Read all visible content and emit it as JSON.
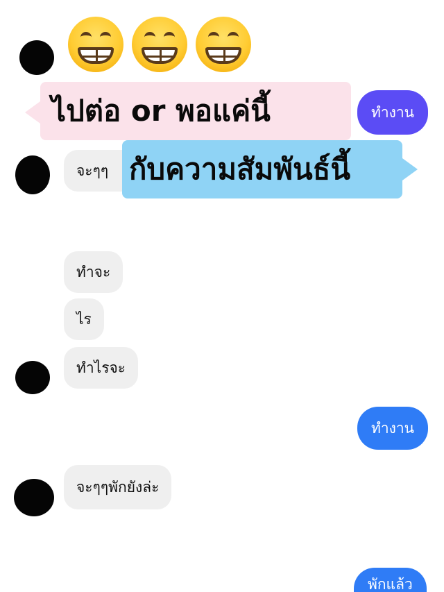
{
  "overlay": {
    "line1": "ไปต่อ or พอแค่นี้",
    "line2": "กับความสัมพันธ์นี้",
    "emojis": [
      "grinning-face-with-smiling-eyes",
      "grinning-face-with-smiling-eyes",
      "grinning-face-with-smiling-eyes"
    ]
  },
  "messages": [
    {
      "side": "sent",
      "text": "ทำงาน"
    },
    {
      "side": "received",
      "text": "จะๆๆ"
    },
    {
      "side": "received",
      "text": "ทำจะ"
    },
    {
      "side": "received",
      "text": "ไร"
    },
    {
      "side": "received",
      "text": "ทำไรจะ"
    },
    {
      "side": "sent",
      "text": "ทำงาน"
    },
    {
      "side": "received",
      "text": "จะๆๆพักยังล่ะ"
    },
    {
      "side": "sent",
      "text": "พักแล้ว"
    }
  ],
  "colors": {
    "sent_bubble": "#2f7cf6",
    "sent_bubble_top": "#5b4cf5",
    "received_bubble": "#efefef",
    "callout_pink": "#fbe2ea",
    "callout_blue": "#8fd3f5"
  }
}
